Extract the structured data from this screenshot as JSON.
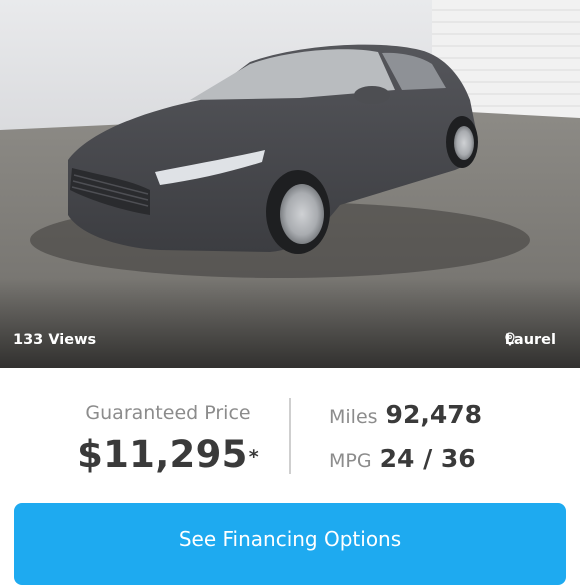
{
  "listing": {
    "views": "133 Views",
    "location": "Laurel",
    "price_label": "Guaranteed Price",
    "price": "$11,295",
    "price_mark": "*",
    "stats": [
      {
        "label": "Miles",
        "value": "92,478"
      },
      {
        "label": "MPG",
        "value": "24 / 36"
      }
    ],
    "cta_label": "See Financing Options"
  },
  "colors": {
    "accent": "#1eaaf0",
    "text_dark": "#3a3a3a",
    "text_muted": "#8c8c8c",
    "car_body": "#4a4b4f"
  },
  "icons": {
    "location": "map-pin-icon"
  }
}
